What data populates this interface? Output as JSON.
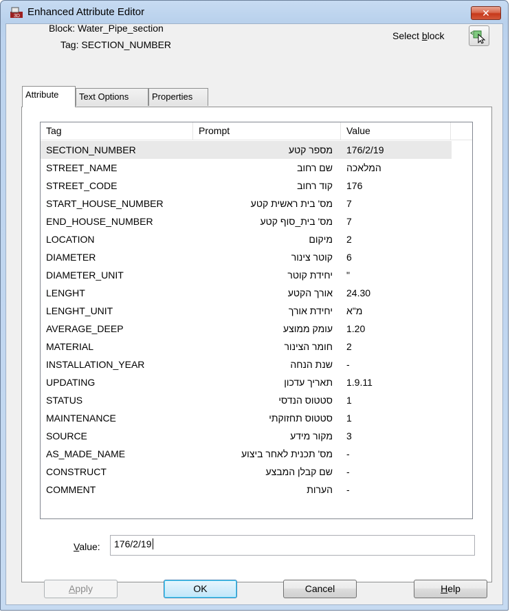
{
  "window": {
    "title": "Enhanced Attribute Editor",
    "close_symbol": "✕"
  },
  "info": {
    "block": "Block: Water_Pipe_section",
    "tag": "Tag: SECTION_NUMBER",
    "select_block_label_pre": "Select ",
    "select_block_label_u": "b",
    "select_block_label_post": "lock",
    "select_block_icon": "select-block-icon"
  },
  "tabs": [
    "Attribute",
    "Text Options",
    "Properties"
  ],
  "grid": {
    "headers": [
      "Tag",
      "Prompt",
      "Value"
    ],
    "rows": [
      {
        "tag": "SECTION_NUMBER",
        "prompt": "מספר קטע",
        "value": "176/2/19"
      },
      {
        "tag": "STREET_NAME",
        "prompt": "שם רחוב",
        "value": "המלאכה"
      },
      {
        "tag": "STREET_CODE",
        "prompt": "קוד רחוב",
        "value": "176"
      },
      {
        "tag": "START_HOUSE_NUMBER",
        "prompt": "מס' בית ראשית קטע",
        "value": "7"
      },
      {
        "tag": "END_HOUSE_NUMBER",
        "prompt": "מס' בית_סוף קטע",
        "value": "7"
      },
      {
        "tag": "LOCATION",
        "prompt": "מיקום",
        "value": "2"
      },
      {
        "tag": "DIAMETER",
        "prompt": "קוטר צינור",
        "value": "6"
      },
      {
        "tag": "DIAMETER_UNIT",
        "prompt": "יחידת קוטר",
        "value": "\""
      },
      {
        "tag": "LENGHT",
        "prompt": "אורך הקטע",
        "value": "24.30"
      },
      {
        "tag": "LENGHT_UNIT",
        "prompt": "יחידת אורך",
        "value": "מ\"א"
      },
      {
        "tag": "AVERAGE_DEEP",
        "prompt": "עומק ממוצע",
        "value": "1.20"
      },
      {
        "tag": "MATERIAL",
        "prompt": "חומר הצינור",
        "value": "2"
      },
      {
        "tag": "INSTALLATION_YEAR",
        "prompt": "שנת הנחה",
        "value": "-"
      },
      {
        "tag": "UPDATING",
        "prompt": "תאריך עדכון",
        "value": "1.9.11"
      },
      {
        "tag": "STATUS",
        "prompt": "סטטוס הנדסי",
        "value": "1"
      },
      {
        "tag": "MAINTENANCE",
        "prompt": "סטטוס תחזוקתי",
        "value": "1"
      },
      {
        "tag": "SOURCE",
        "prompt": "מקור מידע",
        "value": "3"
      },
      {
        "tag": "AS_MADE_NAME",
        "prompt": "מס' תכנית לאחר ביצוע",
        "value": "-"
      },
      {
        "tag": "CONSTRUCT",
        "prompt": "שם קבלן המבצע",
        "value": "-"
      },
      {
        "tag": "COMMENT",
        "prompt": "הערות",
        "value": "-"
      }
    ]
  },
  "value_field": {
    "label_u": "V",
    "label_rest": "alue:",
    "value": "176/2/19"
  },
  "buttons": {
    "apply_u": "A",
    "apply_rest": "pply",
    "ok": "OK",
    "cancel": "Cancel",
    "help_u": "H",
    "help_rest": "elp"
  }
}
